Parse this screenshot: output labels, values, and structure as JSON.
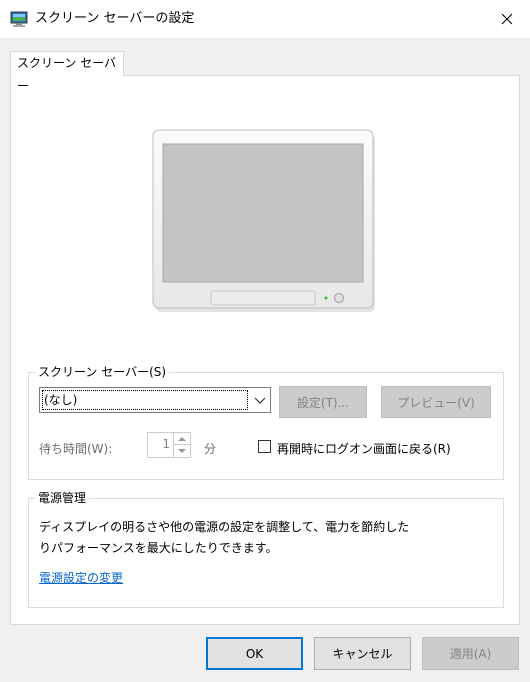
{
  "window": {
    "title": "スクリーン セーバーの設定",
    "icon": "screensaver-app-icon",
    "close_icon": "close-icon"
  },
  "tab": {
    "label": "スクリーン セーバー"
  },
  "screensaver_group": {
    "legend": "スクリーン セーバー(S)",
    "selected_value": "(なし)",
    "settings_button": "設定(T)...",
    "preview_button": "プレビュー(V)",
    "wait_label": "待ち時間(W):",
    "wait_value": "1",
    "wait_unit": "分",
    "logon_checkbox_label": "再開時にログオン画面に戻る(R)",
    "logon_checked": false
  },
  "power_group": {
    "legend": "電源管理",
    "description_line1": "ディスプレイの明るさや他の電源の設定を調整して、電力を節約した",
    "description_line2": "りパフォーマンスを最大にしたりできます。",
    "link": "電源設定の変更"
  },
  "footer": {
    "ok": "OK",
    "cancel": "キャンセル",
    "apply": "適用(A)"
  },
  "colors": {
    "focus_border": "#0078d7",
    "link": "#0066cc",
    "disabled_text": "#838383"
  }
}
